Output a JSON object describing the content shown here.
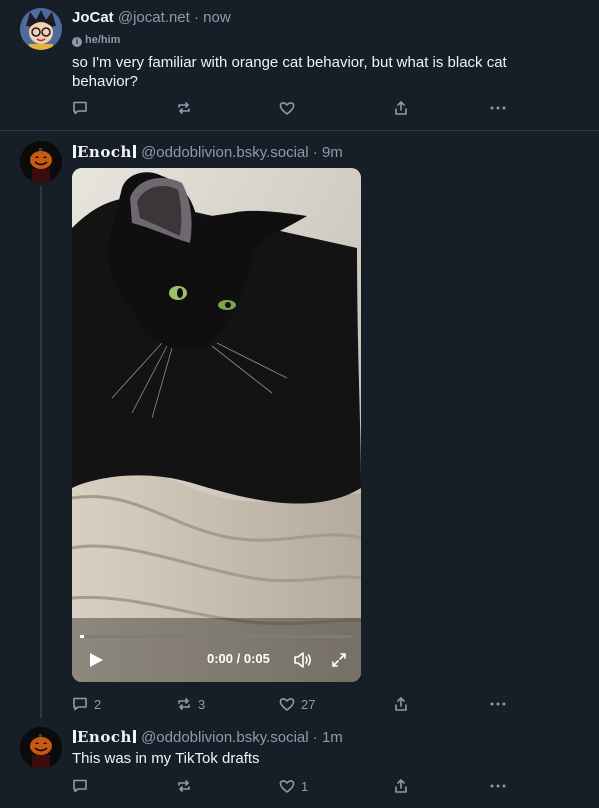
{
  "post1": {
    "name": "JoCat",
    "handle": "@jocat.net",
    "time": "· now",
    "pronoun": "he/him",
    "text": "so I'm very familiar with orange cat behavior, but what is black cat behavior?",
    "counts": {
      "reply": "",
      "repost": "",
      "like": ""
    }
  },
  "post2": {
    "name": "Enoch",
    "handle": "@oddoblivion.bsky.social",
    "time": "· 9m",
    "video": {
      "time": "0:00 / 0:05"
    },
    "counts": {
      "reply": "2",
      "repost": "3",
      "like": "27"
    }
  },
  "post3": {
    "name": "Enoch",
    "handle": "@oddoblivion.bsky.social",
    "time": "· 1m",
    "text": "This was in my TikTok drafts",
    "counts": {
      "reply": "",
      "repost": "",
      "like": "1"
    }
  },
  "colors": {
    "background": "#161e27",
    "muted": "#8d9bab",
    "divider": "#2e3a47"
  }
}
